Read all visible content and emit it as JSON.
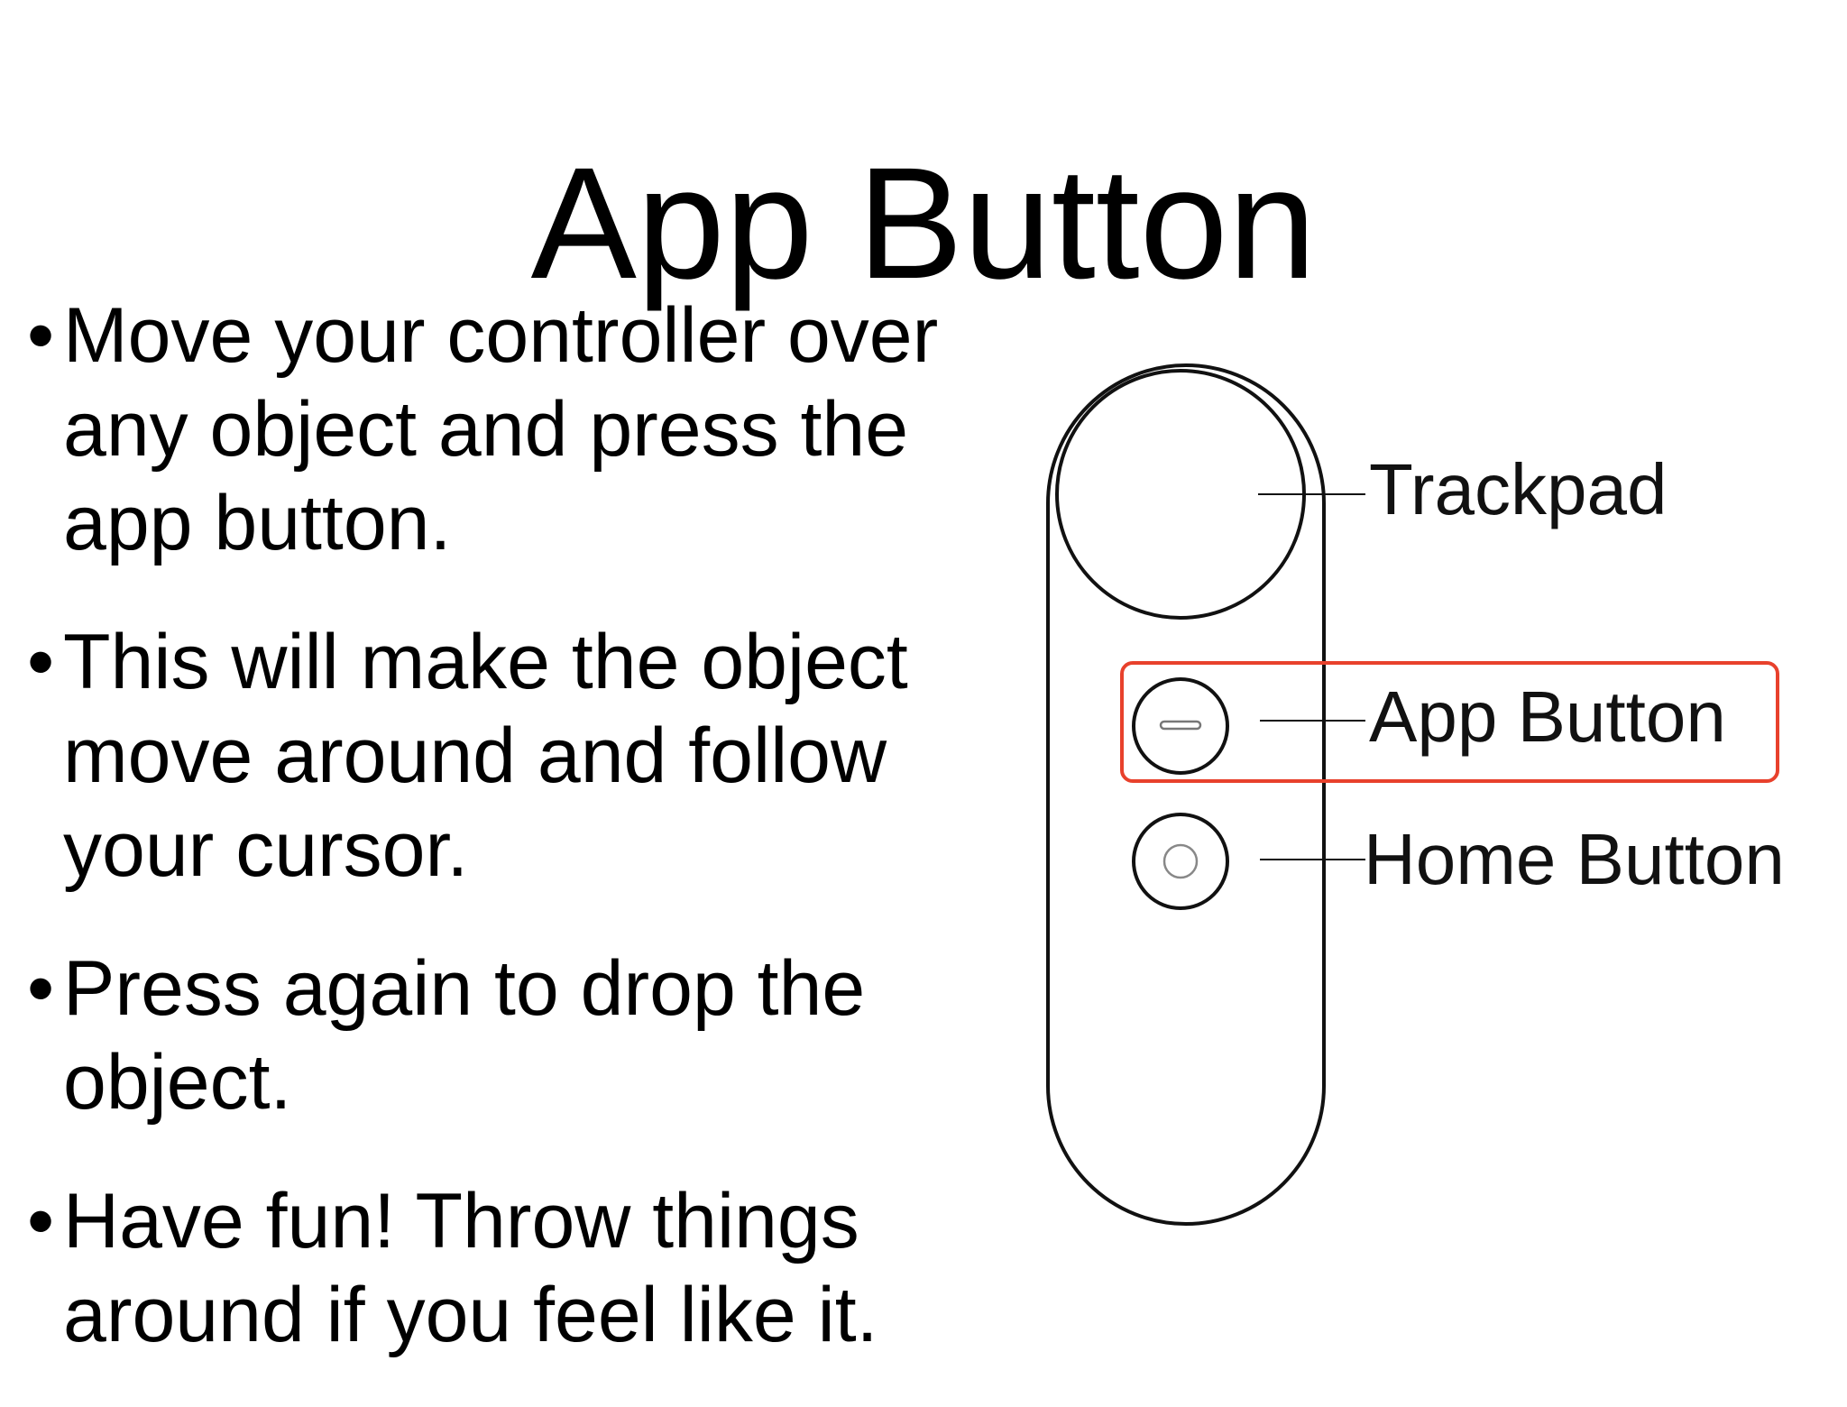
{
  "slide": {
    "title": "App Button",
    "bullets": [
      "Move your controller over any object and press the app button.",
      "This will make the object move around and follow your cursor.",
      "Press again to drop the object.",
      "Have fun! Throw things around if you feel like it."
    ],
    "bullet_symbol": "•"
  },
  "diagram": {
    "labels": {
      "trackpad": "Trackpad",
      "app_button": "App Button",
      "home_button": "Home Button"
    },
    "highlighted_part": "app_button",
    "highlight_color": "#e8412c"
  }
}
